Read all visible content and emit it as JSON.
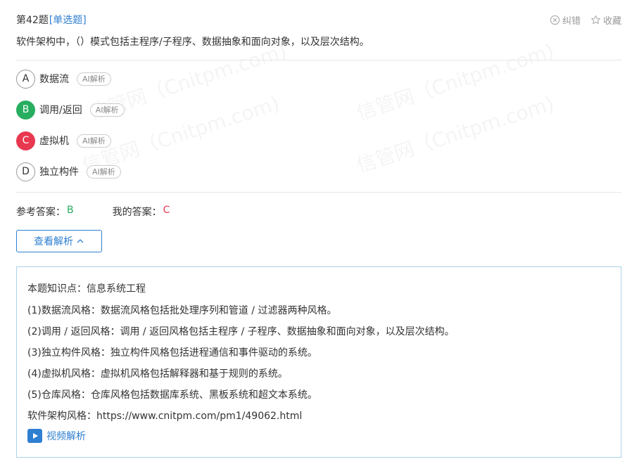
{
  "header": {
    "question_number": "第42题",
    "question_type": "[单选题]",
    "report_label": "纠错",
    "favorite_label": "收藏"
  },
  "question": {
    "text": "软件架构中，（）模式包括主程序/子程序、数据抽象和面向对象，以及层次结构。"
  },
  "options": [
    {
      "letter": "A",
      "text": "数据流",
      "status": "normal"
    },
    {
      "letter": "B",
      "text": "调用/返回",
      "status": "correct"
    },
    {
      "letter": "C",
      "text": "虚拟机",
      "status": "wrong"
    },
    {
      "letter": "D",
      "text": "独立构件",
      "status": "normal"
    }
  ],
  "ai_tag_label": "AI解析",
  "answers": {
    "reference_label": "参考答案：",
    "reference_value": "B",
    "mine_label": "我的答案：",
    "mine_value": "C"
  },
  "toggle_button": {
    "label": "查看解析"
  },
  "analysis": {
    "lines": [
      "本题知识点：信息系统工程",
      "(1)数据流风格：数据流风格包括批处理序列和管道 / 过滤器两种风格。",
      "(2)调用 / 返回风格：调用 / 返回风格包括主程序 / 子程序、数据抽象和面向对象，以及层次结构。",
      "(3)独立构件风格：独立构件风格包括进程通信和事件驱动的系统。",
      "(4)虚拟机风格：虚拟机风格包括解释器和基于规则的系统。",
      "(5)仓库风格：仓库风格包括数据库系统、黑板系统和超文本系统。",
      "软件架构风格：https://www.cnitpm.com/pm1/49062.html"
    ],
    "video_label": "视频解析"
  },
  "watermark": "信管网（Cnitpm.com)",
  "colors": {
    "accent": "#2f7fd1",
    "correct": "#27ae60",
    "wrong": "#e8384f",
    "analysis_border": "#a9d3e6"
  }
}
